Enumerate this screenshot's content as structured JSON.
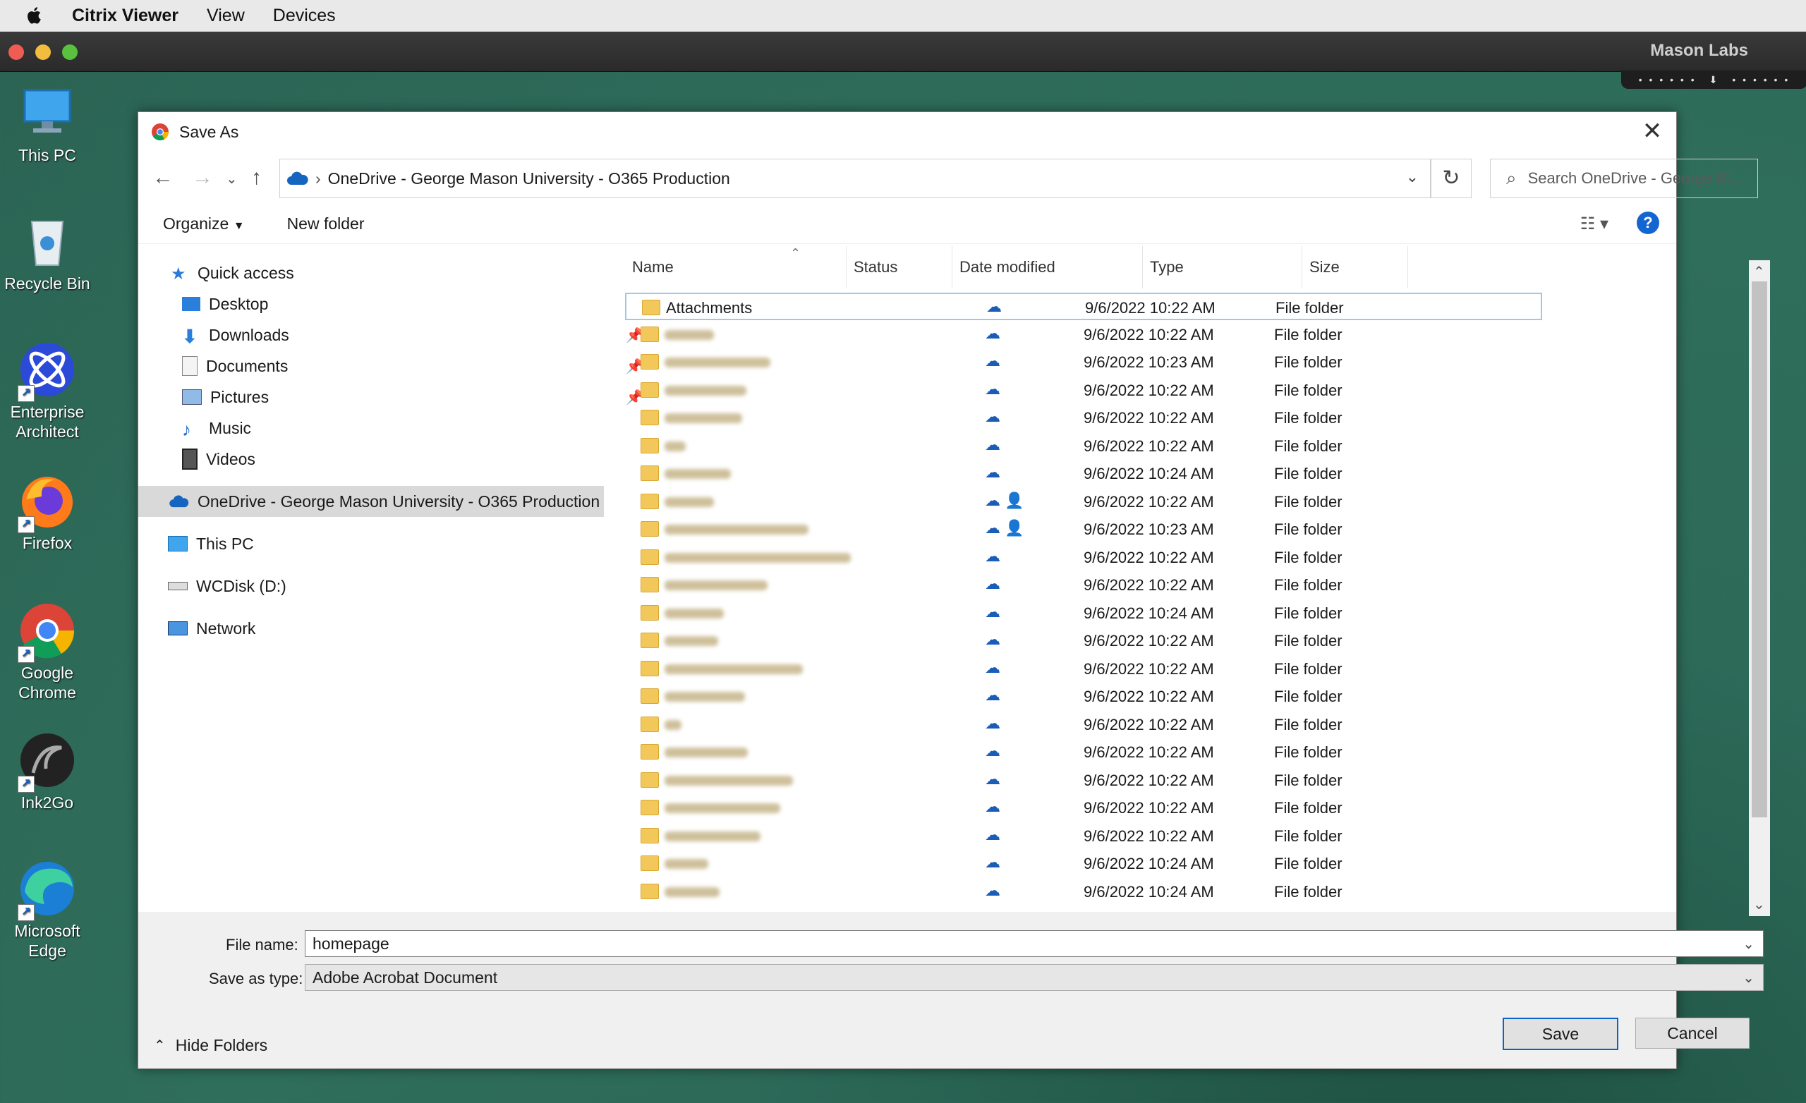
{
  "menubar": {
    "app": "Citrix Viewer",
    "menus": [
      "View",
      "Devices"
    ]
  },
  "citrix": {
    "title": "Mason Labs"
  },
  "desktop": [
    {
      "label": "This PC"
    },
    {
      "label": "Recycle Bin"
    },
    {
      "label": "Enterprise Architect"
    },
    {
      "label": "Firefox"
    },
    {
      "label": "Google Chrome"
    },
    {
      "label": "Ink2Go"
    },
    {
      "label": "Microsoft Edge"
    }
  ],
  "dialog": {
    "title": "Save As",
    "address": "OneDrive - George Mason University - O365 Production",
    "search_placeholder": "Search OneDrive - George M...",
    "toolbar": {
      "organize": "Organize",
      "new_folder": "New folder"
    }
  },
  "nav": {
    "quick_access": "Quick access",
    "items": [
      "Desktop",
      "Downloads",
      "Documents",
      "Pictures",
      "Music",
      "Videos"
    ],
    "onedrive": "OneDrive - George Mason University - O365 Production",
    "this_pc": "This PC",
    "wcdisk": "WCDisk (D:)",
    "network": "Network"
  },
  "columns": {
    "name": "Name",
    "status": "Status",
    "date": "Date modified",
    "type": "Type",
    "size": "Size"
  },
  "files": [
    {
      "name": "Attachments",
      "date": "9/6/2022 10:22 AM",
      "type": "File folder"
    },
    {
      "name": "",
      "date": "9/6/2022 10:22 AM",
      "type": "File folder"
    },
    {
      "name": "",
      "date": "9/6/2022 10:23 AM",
      "type": "File folder"
    },
    {
      "name": "",
      "date": "9/6/2022 10:22 AM",
      "type": "File folder"
    },
    {
      "name": "",
      "date": "9/6/2022 10:22 AM",
      "type": "File folder"
    },
    {
      "name": "",
      "date": "9/6/2022 10:22 AM",
      "type": "File folder"
    },
    {
      "name": "",
      "date": "9/6/2022 10:24 AM",
      "type": "File folder"
    },
    {
      "name": "",
      "date": "9/6/2022 10:22 AM",
      "type": "File folder"
    },
    {
      "name": "",
      "date": "9/6/2022 10:23 AM",
      "type": "File folder"
    },
    {
      "name": "",
      "date": "9/6/2022 10:22 AM",
      "type": "File folder"
    },
    {
      "name": "",
      "date": "9/6/2022 10:22 AM",
      "type": "File folder"
    },
    {
      "name": "",
      "date": "9/6/2022 10:24 AM",
      "type": "File folder"
    },
    {
      "name": "",
      "date": "9/6/2022 10:22 AM",
      "type": "File folder"
    },
    {
      "name": "",
      "date": "9/6/2022 10:22 AM",
      "type": "File folder"
    },
    {
      "name": "",
      "date": "9/6/2022 10:22 AM",
      "type": "File folder"
    },
    {
      "name": "",
      "date": "9/6/2022 10:22 AM",
      "type": "File folder"
    },
    {
      "name": "",
      "date": "9/6/2022 10:22 AM",
      "type": "File folder"
    },
    {
      "name": "",
      "date": "9/6/2022 10:22 AM",
      "type": "File folder"
    },
    {
      "name": "",
      "date": "9/6/2022 10:22 AM",
      "type": "File folder"
    },
    {
      "name": "",
      "date": "9/6/2022 10:22 AM",
      "type": "File folder"
    },
    {
      "name": "",
      "date": "9/6/2022 10:24 AM",
      "type": "File folder"
    },
    {
      "name": "",
      "date": "9/6/2022 10:24 AM",
      "type": "File folder"
    }
  ],
  "form": {
    "file_name_label": "File name:",
    "file_name_value": "homepage",
    "save_type_label": "Save as type:",
    "save_type_value": "Adobe Acrobat Document",
    "hide_folders": "Hide Folders",
    "save": "Save",
    "cancel": "Cancel"
  }
}
